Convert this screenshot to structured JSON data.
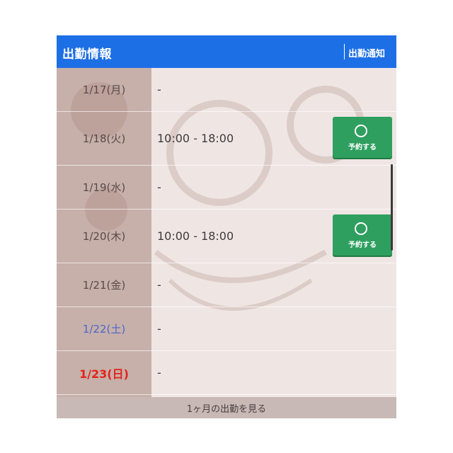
{
  "header": {
    "title": "出勤情報",
    "notify_label": "出勤通知"
  },
  "schedule": [
    {
      "date": "1/17(月)",
      "time": "-",
      "day_type": "weekday",
      "reservable": false
    },
    {
      "date": "1/18(火)",
      "time": "10:00 - 18:00",
      "day_type": "weekday",
      "reservable": true
    },
    {
      "date": "1/19(水)",
      "time": "-",
      "day_type": "weekday",
      "reservable": false
    },
    {
      "date": "1/20(木)",
      "time": "10:00 - 18:00",
      "day_type": "weekday",
      "reservable": true
    },
    {
      "date": "1/21(金)",
      "time": "-",
      "day_type": "weekday",
      "reservable": false
    },
    {
      "date": "1/22(土)",
      "time": "-",
      "day_type": "saturday",
      "reservable": false
    },
    {
      "date": "1/23(日)",
      "time": "-",
      "day_type": "sunday",
      "reservable": false
    }
  ],
  "reserve_button": {
    "symbol": "〇",
    "label": "予約する"
  },
  "footer": {
    "link_label": "1ヶ月の出勤を見る"
  },
  "colors": {
    "header": "#1d6fe6",
    "button": "#2f9f5f",
    "saturday": "#4a66c8",
    "sunday": "#e2231a"
  }
}
